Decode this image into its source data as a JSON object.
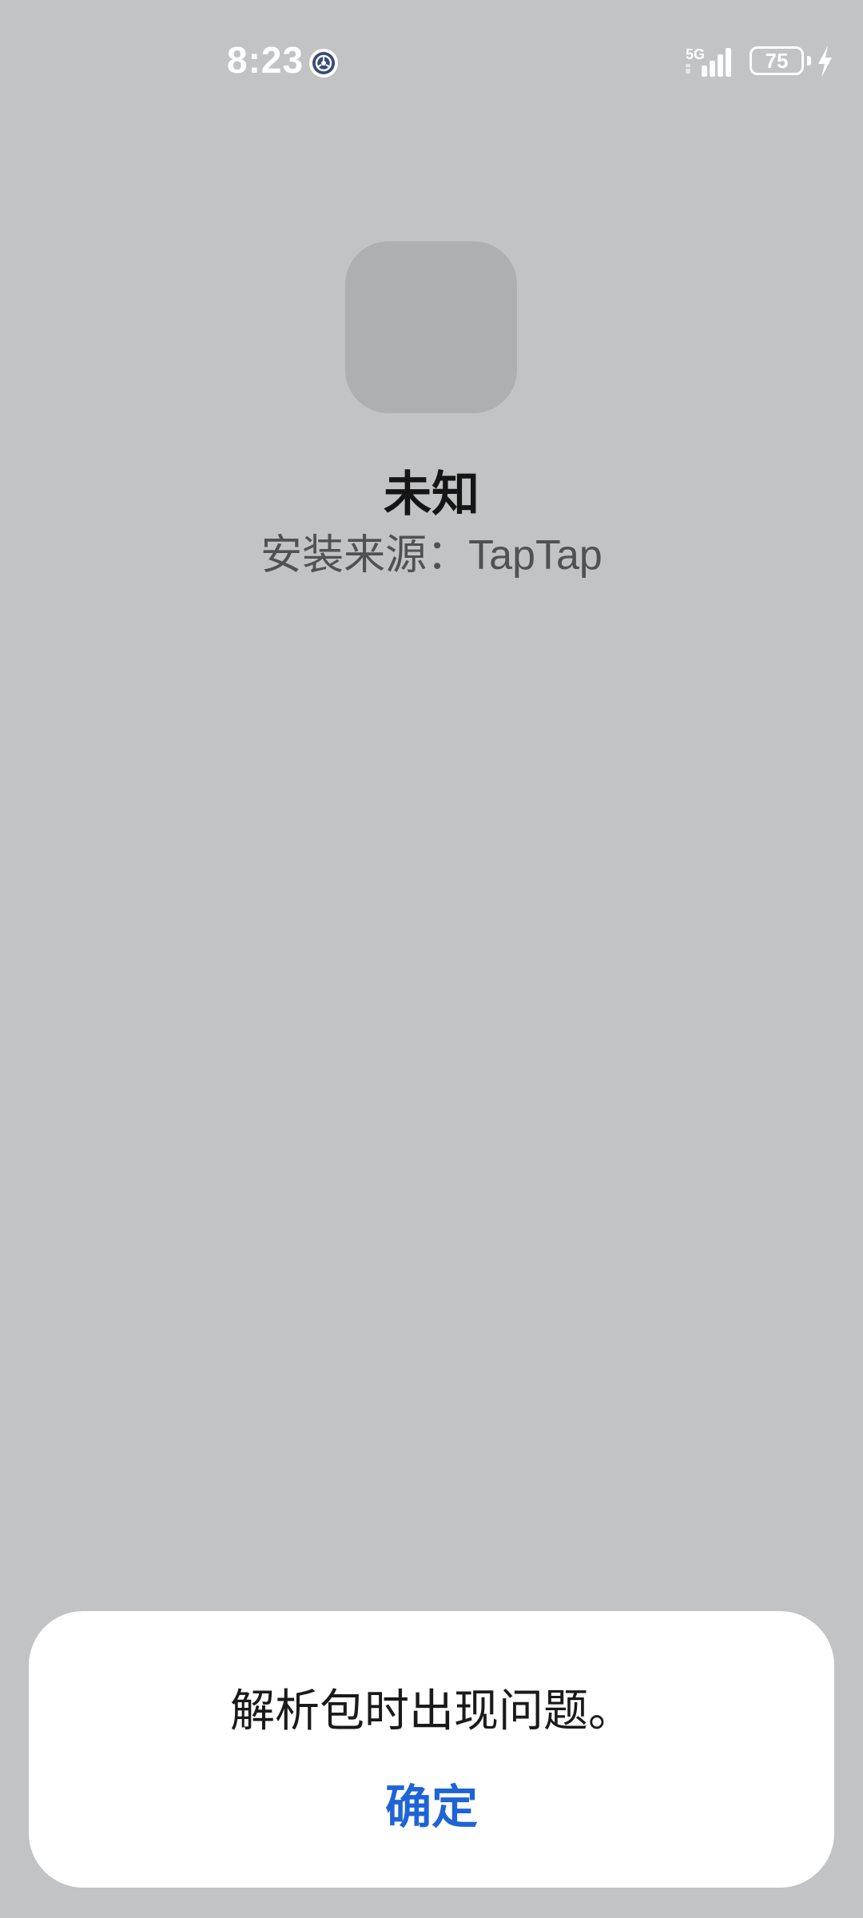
{
  "status_bar": {
    "time": "8:23",
    "network": "5G",
    "battery": "75"
  },
  "app": {
    "name": "未知",
    "source_label": "安装来源：",
    "source_value": "TapTap"
  },
  "dialog": {
    "message": "解析包时出现问题。",
    "confirm_label": "确定"
  },
  "colors": {
    "background": "#c2c3c5",
    "accent": "#1f64d6"
  }
}
